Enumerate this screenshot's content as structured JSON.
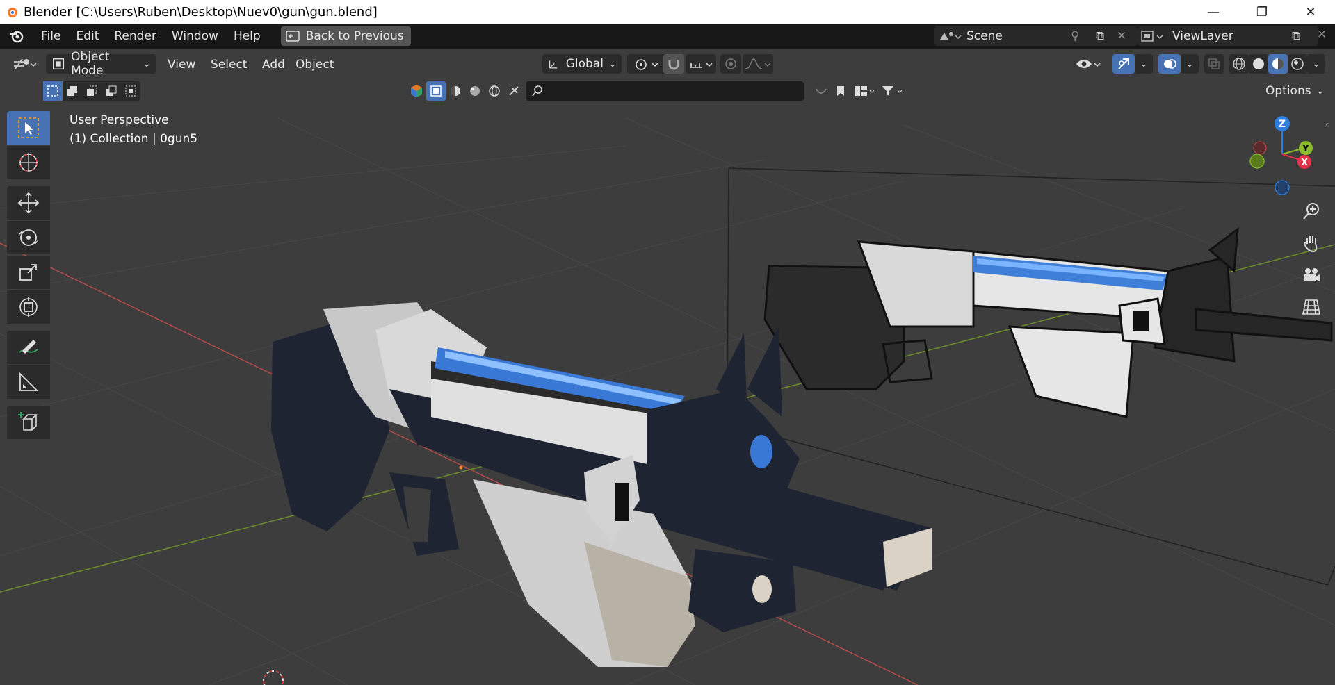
{
  "window": {
    "title": "Blender [C:\\Users\\Ruben\\Desktop\\Nuev0\\gun\\gun.blend]",
    "controls": [
      "—",
      "❐",
      "✕"
    ]
  },
  "menu": {
    "items": [
      "File",
      "Edit",
      "Render",
      "Window",
      "Help"
    ],
    "back_button": "Back to Previous",
    "scene": "Scene",
    "view_layer": "ViewLayer"
  },
  "header": {
    "mode": "Object Mode",
    "menus": [
      "View",
      "Select",
      "Add",
      "Object"
    ],
    "orientation": "Global",
    "options": "Options"
  },
  "outliner_filter": {
    "search_placeholder": ""
  },
  "viewport": {
    "perspective": "User Perspective",
    "collection": "(1) Collection | 0gun5"
  },
  "gizmo": {
    "z": "Z",
    "y": "Y",
    "x": "X"
  },
  "colors": {
    "accent": "#4772b3",
    "viewport_bg": "#3d3d3d",
    "x_axis": "#e5324b",
    "y_axis": "#8bbb2a",
    "z_axis": "#2e7fe0"
  }
}
